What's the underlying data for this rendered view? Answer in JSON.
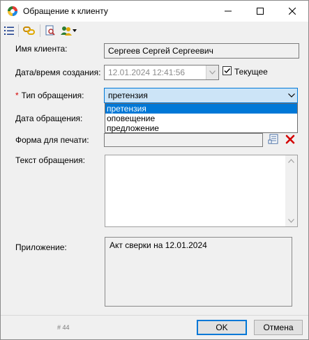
{
  "window": {
    "title": "Обращение к клиенту"
  },
  "form": {
    "client_name_label": "Имя клиента:",
    "client_name_value": "Сергеев Сергей Сергеевич",
    "created_label": "Дата/время создания:",
    "created_value": "12.01.2024 12:41:56",
    "current_checkbox_label": "Текущее",
    "current_checked": true,
    "type_required_mark": "*",
    "type_label": "Тип обращения:",
    "type_value": "претензия",
    "type_options": [
      "претензия",
      "оповещение",
      "предложение"
    ],
    "date_label": "Дата обращения:",
    "print_form_label": "Форма для печати:",
    "text_label": "Текст обращения:",
    "text_value": "",
    "attachment_label": "Приложение:",
    "attachment_value": "Акт сверки на 12.01.2024"
  },
  "footer": {
    "code": "# 44",
    "ok_label": "OK",
    "cancel_label": "Отмена"
  },
  "colors": {
    "selection": "#0078d7",
    "combo_highlight": "#cce4f7",
    "required": "#d40000",
    "delete": "#d40000"
  }
}
